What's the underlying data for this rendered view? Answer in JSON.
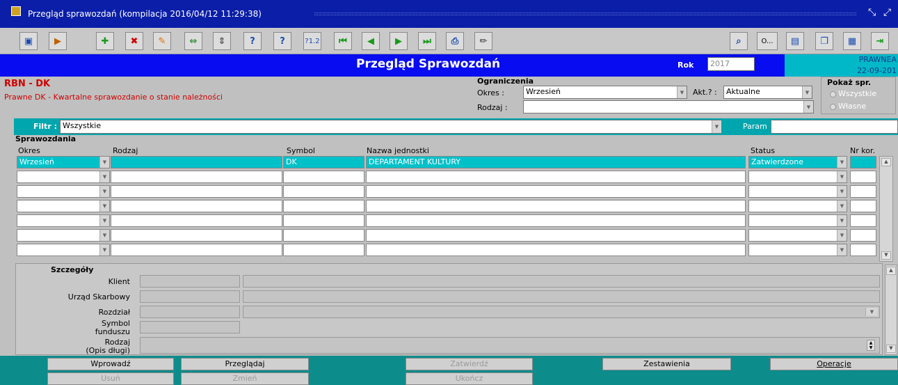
{
  "window": {
    "title": "Przegląd sprawozdań (kompilacja 2016/04/12 11:29:38)"
  },
  "toolbar": {
    "items": [
      "save-icon",
      "next-icon",
      "add-icon",
      "delete-icon",
      "edit-icon",
      "expand-icon",
      "collapse-icon",
      "help-icon",
      "help2-icon",
      "help12-icon",
      "first-icon",
      "prev-icon",
      "next-record-icon",
      "last-icon",
      "print-icon",
      "pen-icon",
      "preview-icon",
      "more",
      "doc-icon",
      "copy-icon",
      "calc-icon",
      "exit-icon"
    ],
    "more_label": "O..."
  },
  "header": {
    "title": "Przegląd Sprawozdań",
    "rok_label": "Rok",
    "rok_value": "2017",
    "right_line1": "PRAWNEA",
    "right_line2": "22-09-201"
  },
  "report": {
    "code": "RBN - DK",
    "description": "Prawne DK - Kwartalne sprawozdanie o stanie należności"
  },
  "ograniczenia": {
    "title": "Ograniczenia",
    "okres_label": "Okres :",
    "okres_value": "Wrzesień",
    "akt_label": "Akt.? :",
    "akt_value": "Aktualne",
    "rodzaj_label": "Rodzaj :",
    "rodzaj_value": ""
  },
  "pokaz": {
    "title": "Pokaż spr.",
    "opt1": "Wszystkie",
    "opt2": "Własne"
  },
  "filter": {
    "label": "Filtr :",
    "value": "Wszystkie",
    "param_label": "Param",
    "param_value": ""
  },
  "grid": {
    "section": "Sprawozdania",
    "headers": {
      "okres": "Okres",
      "rodzaj": "Rodzaj",
      "symbol": "Symbol",
      "nazwa": "Nazwa jednostki",
      "status": "Status",
      "nrkor": "Nr kor."
    },
    "rows": [
      {
        "okres": "Wrzesień",
        "rodzaj": "",
        "symbol": "DK",
        "nazwa": "DEPARTAMENT KULTURY",
        "status": "Zatwierdzone",
        "nrkor": ""
      },
      {
        "okres": "",
        "rodzaj": "",
        "symbol": "",
        "nazwa": "",
        "status": "",
        "nrkor": ""
      },
      {
        "okres": "",
        "rodzaj": "",
        "symbol": "",
        "nazwa": "",
        "status": "",
        "nrkor": ""
      },
      {
        "okres": "",
        "rodzaj": "",
        "symbol": "",
        "nazwa": "",
        "status": "",
        "nrkor": ""
      },
      {
        "okres": "",
        "rodzaj": "",
        "symbol": "",
        "nazwa": "",
        "status": "",
        "nrkor": ""
      },
      {
        "okres": "",
        "rodzaj": "",
        "symbol": "",
        "nazwa": "",
        "status": "",
        "nrkor": ""
      },
      {
        "okres": "",
        "rodzaj": "",
        "symbol": "",
        "nazwa": "",
        "status": "",
        "nrkor": ""
      }
    ]
  },
  "details": {
    "title": "Szczegóły",
    "klient": "Klient",
    "urzad": "Urząd Skarbowy",
    "rozdzial": "Rozdział",
    "symbol_line1": "Symbol",
    "symbol_line2": "funduszu",
    "rodzaj_line1": "Rodzaj",
    "rodzaj_line2": "(Opis długi)"
  },
  "buttons": {
    "wprowadz": "Wprowadź",
    "przegladaj": "Przeglądaj",
    "zatwierdz": "Zatwierdź",
    "zestawienia": "Zestawienia",
    "operacje": "Operacje",
    "usun": "Usuń",
    "zmien": "Zmień",
    "ukoncz": "Ukończ"
  },
  "colors": {
    "titlebar": "#0a1ea8",
    "header": "#080cf0",
    "accent": "#00c0c8",
    "bottombar": "#0d8c8c",
    "red": "#d00000"
  }
}
